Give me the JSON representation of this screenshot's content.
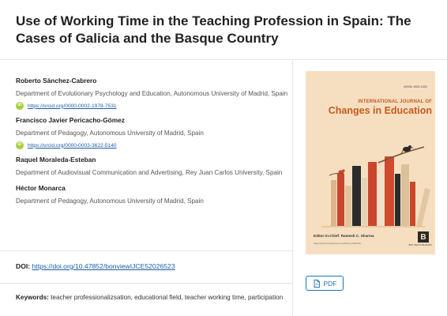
{
  "article": {
    "title": "Use of Working Time in the Teaching Profession in Spain: The Cases of Galicia and the Basque Country"
  },
  "authors": [
    {
      "name": "Roberto Sánchez-Cabrero",
      "affiliation": "Department of Evolutionary Psychology and Education, Autonomous University of Madrid, Spain",
      "orcid": "https://orcid.org/0000-0002-1978-7531"
    },
    {
      "name": "Francisco Javier Pericacho-Gómez",
      "affiliation": "Department of Pedagogy, Autonomous University of Madrid, Spain",
      "orcid": "https://orcid.org/0000-0003-3622-5140"
    },
    {
      "name": "Raquel Moraleda-Esteban",
      "affiliation": "Department of Audiovisual Communication and Advertising, Rey Juan Carlos University, Spain",
      "orcid": ""
    },
    {
      "name": "Héctor Monarca",
      "affiliation": "Department of Pedagogy, Autonomous University of Madrid, Spain",
      "orcid": ""
    }
  ],
  "doi": {
    "label": "DOI:",
    "link": "https://doi.org/10.47852/bonviewIJCE52026523"
  },
  "keywords": {
    "label": "Keywords:",
    "text": "teacher professionalizsation, educational field, teacher working time, participation"
  },
  "orcid_icon_text": "iD",
  "cover": {
    "issn": "eISSN: 3029-133X",
    "journal_title_line1": "INTERNATIONAL JOURNAL OF",
    "journal_title_line2": "Changes in Education",
    "editor": "Editor-in-Chief: Ramesh C. Sharma",
    "url": "https://ojs.bonviewpress.com/index.php/IJCE",
    "publisher_logo": "B",
    "publisher_name": "BON VIEW PUBLISHING",
    "accent_color": "#c85a1e",
    "background_color": "#f6dfc1"
  },
  "pdf_button": {
    "label": "PDF",
    "icon": "document-icon"
  }
}
